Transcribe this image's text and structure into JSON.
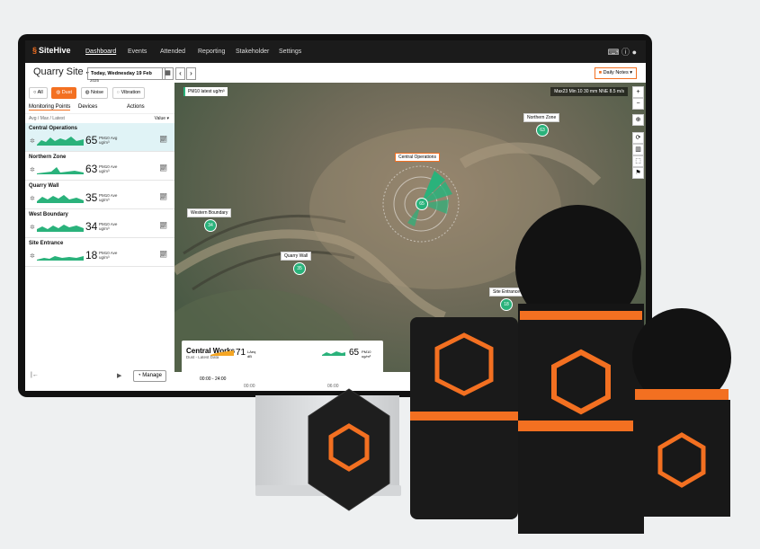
{
  "nav": {
    "brand": "SiteHive",
    "items": [
      "Dashboard",
      "Events",
      "Attended",
      "Reporting",
      "Stakeholder",
      "Settings"
    ],
    "active": "Dashboard"
  },
  "header": {
    "site": "Quarry Site",
    "date": "Today, Wednesday 19 Feb",
    "year": "2025",
    "daily_notes": "Daily Notes"
  },
  "filters": [
    "All",
    "Dust",
    "Noise",
    "Vibration"
  ],
  "active_filter": "Dust",
  "tabs": [
    "Monitoring Points",
    "Devices",
    "Actions"
  ],
  "sort": {
    "left": "Avg / Max / Latest",
    "right": "Value"
  },
  "points": [
    {
      "name": "Central Operations",
      "value": "65",
      "unit1": "PM10 Avg",
      "unit2": "ug/m³"
    },
    {
      "name": "Northern Zone",
      "value": "63",
      "unit1": "PM10 Ave",
      "unit2": "ug/m³"
    },
    {
      "name": "Quarry Wall",
      "value": "35",
      "unit1": "PM10 Ave",
      "unit2": "ug/m³"
    },
    {
      "name": "West Boundary",
      "value": "34",
      "unit1": "PM10 Ave",
      "unit2": "ug/m³"
    },
    {
      "name": "Site Entrance",
      "value": "18",
      "unit1": "PM10 Ave",
      "unit2": "ug/m³"
    }
  ],
  "panel_footer": {
    "manage": "Manage"
  },
  "map": {
    "pm_label": "PM10 latest ug/m³",
    "weather": "Max23  Min 10   30 mm   NNE 8.5 m/s",
    "pins": [
      {
        "label": "Northern Zone",
        "value": "63"
      },
      {
        "label": "Central Operations",
        "value": "65"
      },
      {
        "label": "Western Boundary",
        "value": "34"
      },
      {
        "label": "Quarry Wall",
        "value": "35"
      },
      {
        "label": "Site Entrance",
        "value": "18"
      }
    ]
  },
  "info_card": {
    "title": "Central Works",
    "subtitle": "Dust - Latest Data",
    "metric1_value": "71",
    "metric1_unit1": "LAeq",
    "metric1_unit2": "dB",
    "metric2_value": "65",
    "metric2_unit1": "PM10",
    "metric2_unit2": "ug/m³"
  },
  "timeline": {
    "range": "00:00 - 24:00",
    "tick1": "00:00",
    "tick2": "06:00"
  },
  "colors": {
    "accent": "#f37021",
    "green": "#2ab27b",
    "selected_row": "#e0f3f6"
  }
}
